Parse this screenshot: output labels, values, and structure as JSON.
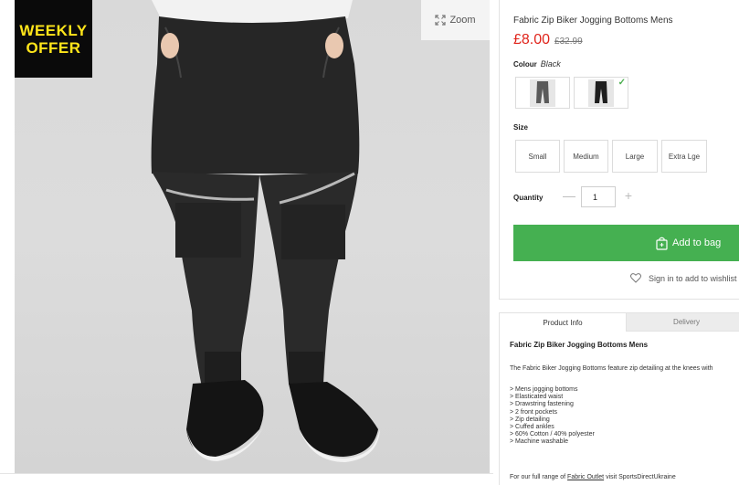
{
  "badge": {
    "line1": "WEEKLY",
    "line2": "OFFER"
  },
  "zoom": {
    "label": "Zoom",
    "icon": "expand-icon"
  },
  "product": {
    "title": "Fabric Zip Biker Jogging Bottoms Mens",
    "price": "£8.00",
    "was_price": "£32.99",
    "colour_label": "Colour",
    "colour_value": "Black",
    "swatches": [
      {
        "name": "Grey",
        "selected": false
      },
      {
        "name": "Black",
        "selected": true
      }
    ],
    "size_label": "Size",
    "sizes": [
      "Small",
      "Medium",
      "Large",
      "Extra Lge"
    ],
    "quantity_label": "Quantity",
    "quantity_value": "1",
    "add_to_bag": "Add to bag",
    "wishlist": "Sign in to add to wishlist"
  },
  "info": {
    "tabs": [
      "Product Info",
      "Delivery"
    ],
    "title": "Fabric Zip Biker Jogging Bottoms Mens",
    "description": "The Fabric Biker Jogging Bottoms feature zip detailing at the knees with",
    "bullets": [
      "> Mens jogging bottoms",
      "> Elasticated waist",
      "> Drawstring fastening",
      "> 2 front pockets",
      "> Zip detailing",
      "> Cuffed ankles",
      "> 60% Cotton / 40% polyester",
      "> Machine washable"
    ],
    "outlet_prefix": "For our full range of",
    "outlet_link": "Fabric Outlet",
    "outlet_suffix": "visit SportsDirectUkraine"
  },
  "colors": {
    "price": "#e0241b",
    "button": "#45b051",
    "badge_bg": "#0a0a0a",
    "badge_text": "#ffe51a"
  }
}
